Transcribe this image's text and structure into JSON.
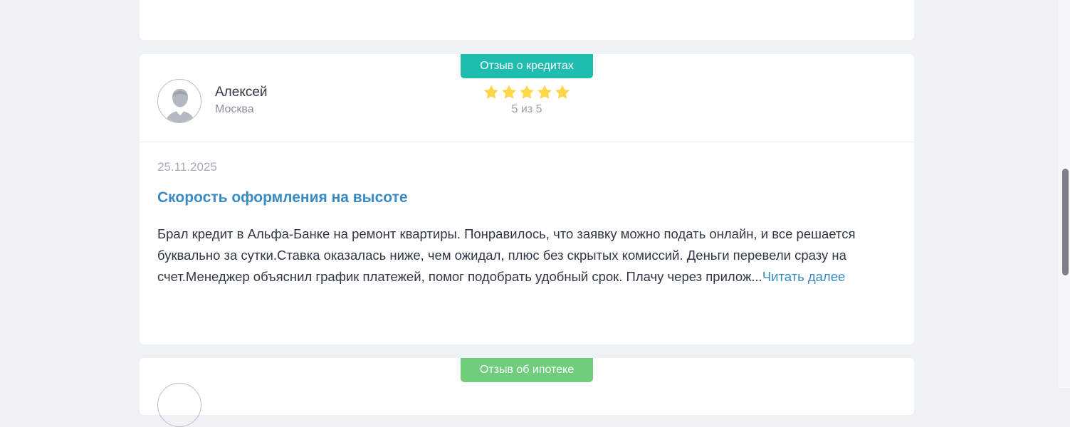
{
  "reviews": [
    {
      "badge": "Отзыв о кредитах",
      "badge_color": "#1fbcb0",
      "author": "Алексей",
      "city": "Москва",
      "rating": 5,
      "rating_text": "5 из 5",
      "date": "25.11.2025",
      "title": "Скорость оформления на высоте",
      "text": "Брал кредит в Альфа-Банке на ремонт квартиры. Понравилось, что заявку можно подать онлайн, и все решается буквально за сутки.Ставка оказалась ниже, чем ожидал, плюс без скрытых комиссий. Деньги перевели сразу на счет.Менеджер объяснил график платежей, помог подобрать удобный срок. Плачу через прилож...",
      "read_more": "Читать далее"
    },
    {
      "badge": "Отзыв об ипотеке",
      "badge_color": "#6fcd7b"
    }
  ],
  "colors": {
    "background": "#eff2f5",
    "link": "#3a8bc3",
    "star": "#ffd54a"
  }
}
